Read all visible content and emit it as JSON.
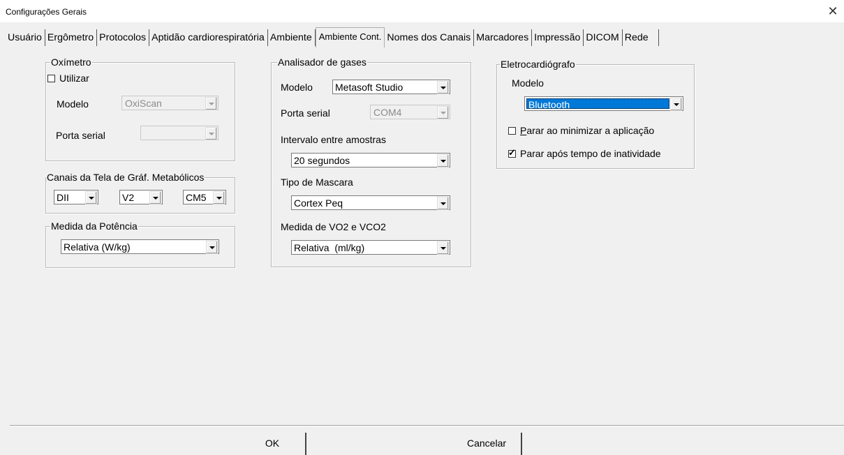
{
  "window": {
    "title": "Configurações Gerais",
    "close_glyph": "✕"
  },
  "tabs": [
    {
      "label": "Usuário"
    },
    {
      "label": "Ergômetro"
    },
    {
      "label": "Protocolos"
    },
    {
      "label": "Aptidão cardiorespiratória"
    },
    {
      "label": "Ambiente"
    },
    {
      "label": "Ambiente Cont.",
      "active": true
    },
    {
      "label": "Nomes dos Canais"
    },
    {
      "label": "Marcadores"
    },
    {
      "label": "Impressão"
    },
    {
      "label": "DICOM"
    },
    {
      "label": "Rede"
    }
  ],
  "oximetro": {
    "title": "Oxímetro",
    "utilizar_label": "Utilizar",
    "utilizar_checked": false,
    "modelo_label": "Modelo",
    "modelo_value": "OxiScan",
    "porta_label": "Porta serial",
    "porta_value": ""
  },
  "canais": {
    "title": "Canais da Tela de Gráf. Metabólicos",
    "c1": "DII",
    "c2": "V2",
    "c3": "CM5"
  },
  "potencia": {
    "title": "Medida da Potência",
    "value": "Relativa (W/kg)"
  },
  "gases": {
    "title": "Analisador de gases",
    "modelo_label": "Modelo",
    "modelo_value": "Metasoft Studio",
    "porta_label": "Porta serial",
    "porta_value": "COM4",
    "intervalo_label": "Intervalo entre amostras",
    "intervalo_value": "20 segundos",
    "mascara_label": "Tipo de Mascara",
    "mascara_value": "Cortex Peq",
    "vo2_label": "Medida de VO2 e VCO2",
    "vo2_value": "Relativa  (ml/kg)"
  },
  "ecg": {
    "title": "Eletrocardiógrafo",
    "modelo_label": "Modelo",
    "modelo_value": "Bluetooth",
    "parar_min_prefix": "P",
    "parar_min_rest": "arar ao minimizar  a aplicação",
    "parar_min_checked": false,
    "parar_inat_label": "Parar após tempo de inatividade",
    "parar_inat_checked": true
  },
  "buttons": {
    "ok": "OK",
    "cancel": "Cancelar"
  }
}
